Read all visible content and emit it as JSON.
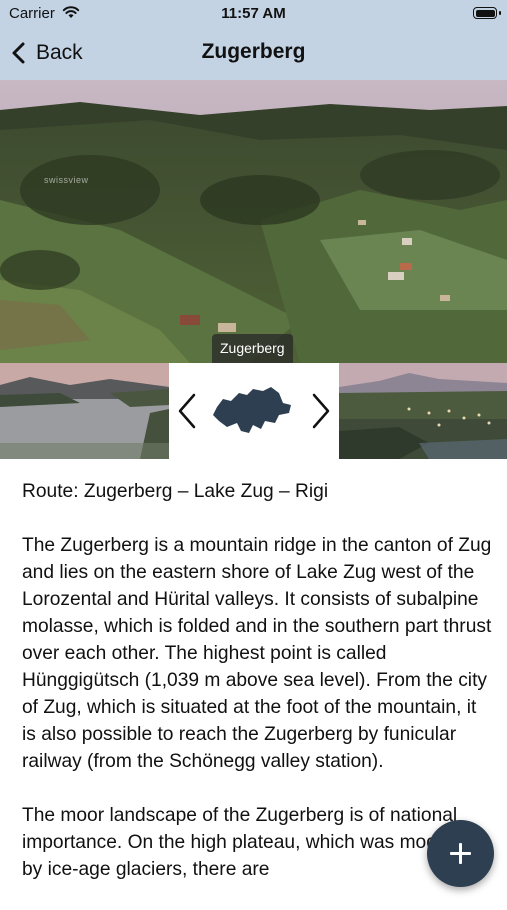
{
  "status_bar": {
    "carrier": "Carrier",
    "time": "11:57 AM",
    "wifi_icon": "wifi-icon",
    "battery_icon": "battery-icon"
  },
  "nav": {
    "back_label": "Back",
    "title": "Zugerberg",
    "back_icon": "chevron-left-icon"
  },
  "hero": {
    "caption": "Zugerberg",
    "watermark": "swissview"
  },
  "gallery": {
    "prev_icon": "chevron-left-icon",
    "next_icon": "chevron-right-icon",
    "map_icon": "switzerland-map-icon"
  },
  "content": {
    "route": "Route: Zugerberg – Lake Zug – Rigi",
    "paragraphs": [
      "The Zugerberg is a mountain ridge in the canton of Zug and lies on the eastern shore of Lake Zug west of the Lorozental and Hürital valleys. It consists of subalpine molasse, which is folded and in the southern part thrust over each other. The highest point is called Hünggigütsch (1,039 m above sea level). From the city of Zug, which is situated at the foot of the mountain, it is also possible to reach the Zugerberg by funicular railway (from the Schönegg valley station).",
      "The moor landscape of the Zugerberg is of national importance. On the high plateau, which was modeled by ice-age glaciers, there are"
    ]
  },
  "fab": {
    "icon": "plus-icon"
  },
  "colors": {
    "bar_background": "#c3d3e4",
    "fab_background": "#2e3f52",
    "map_fill": "#2e3f52"
  }
}
